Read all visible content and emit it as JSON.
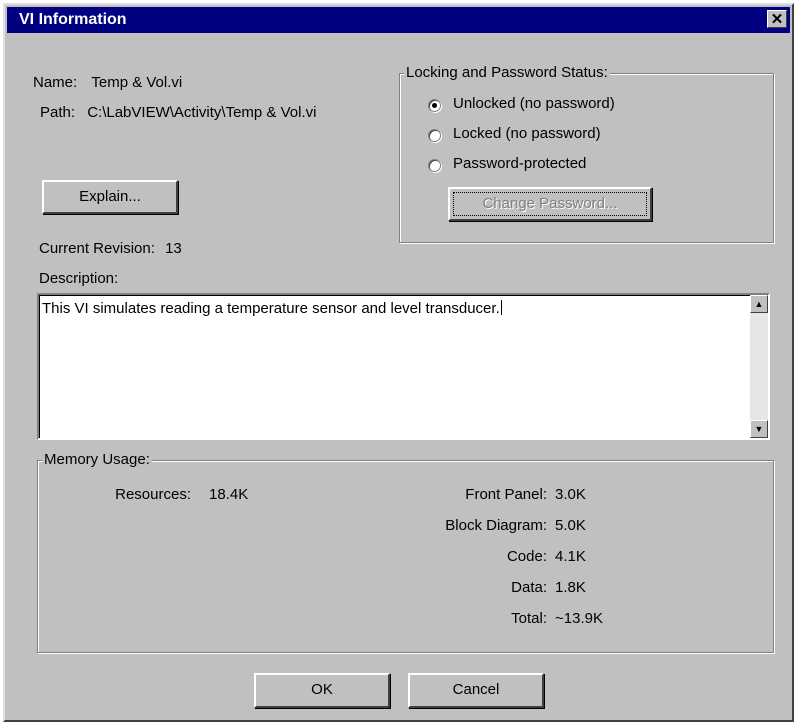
{
  "window": {
    "title": "VI Information",
    "close_glyph": "✕"
  },
  "info": {
    "name_label": "Name:",
    "name_value": "Temp & Vol.vi",
    "path_label": "Path:",
    "path_value": "C:\\LabVIEW\\Activity\\Temp & Vol.vi",
    "explain_button": "Explain...",
    "revision_label": "Current Revision:",
    "revision_value": "13",
    "description_label": "Description:",
    "description_text": "This VI simulates reading a temperature sensor and level transducer."
  },
  "locking": {
    "title": "Locking and Password Status:",
    "options": [
      {
        "label": "Unlocked (no password)",
        "selected": true
      },
      {
        "label": "Locked (no password)",
        "selected": false
      },
      {
        "label": "Password-protected",
        "selected": false
      }
    ],
    "change_password_button": "Change Password..."
  },
  "memory": {
    "title": "Memory Usage:",
    "resources_label": "Resources:",
    "resources_value": "18.4K",
    "rows": [
      {
        "label": "Front Panel:",
        "value": "3.0K"
      },
      {
        "label": "Block Diagram:",
        "value": "5.0K"
      },
      {
        "label": "Code:",
        "value": "4.1K"
      },
      {
        "label": "Data:",
        "value": "1.8K"
      },
      {
        "label": "Total:",
        "value": "~13.9K"
      }
    ]
  },
  "footer": {
    "ok_button": "OK",
    "cancel_button": "Cancel"
  },
  "colors": {
    "title_bar": "#000080",
    "dialog_face": "#c0c0c0"
  }
}
